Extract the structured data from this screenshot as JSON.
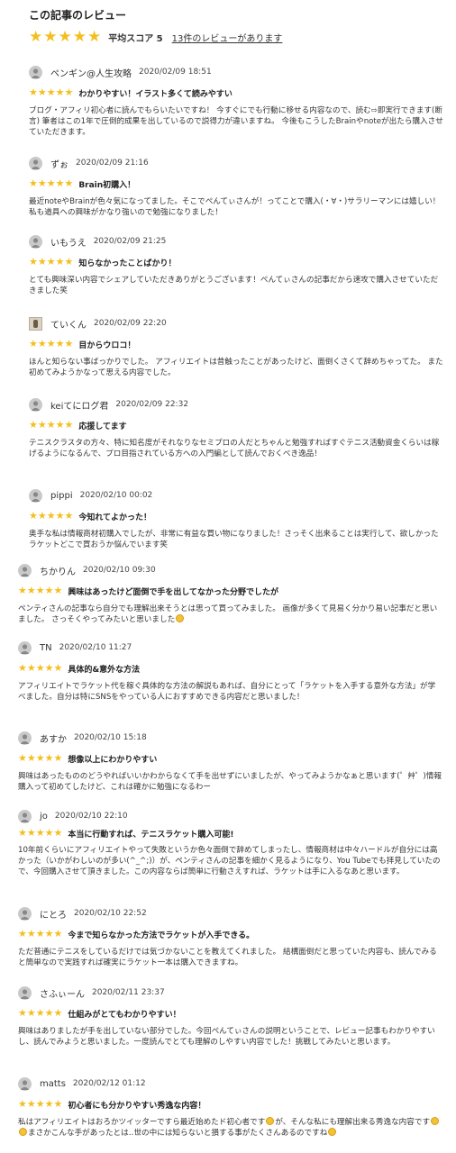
{
  "header": {
    "title": "この記事のレビュー",
    "stars": "★★★★★",
    "average_label": "平均スコア 5",
    "review_count_link": "13件のレビューがあります"
  },
  "colors": {
    "star": "#f3bf1f",
    "avatar": "#c9c9c9"
  },
  "reviews": [
    {
      "user": "ペンギン@人生攻略",
      "date": "2020/02/09 18:51",
      "stars": "★★★★★",
      "title": "わかりやすい！イラスト多くて読みやすい",
      "body_parts": [
        "ブログ・アフィリ初心者に読んでもらいたいですね！ 今すぐにでも行動に移せる内容なので、読む⇨即実行できます(断言) 筆者はこの1年で圧倒的成果を出しているので説得力が違いますね。 今後もこうしたBrainやnoteが出たら購入させていただきます。"
      ]
    },
    {
      "user": "ずぉ",
      "date": "2020/02/09 21:16",
      "stars": "★★★★★",
      "title": "Brain初購入！",
      "body_parts": [
        "最近noteやBrainが色々気になってました。そこでぺんてぃさんが！ってことで購入(・∀・)サラリーマンには嬉しい！私も道具への興味がかなり強いので勉強になりました！"
      ]
    },
    {
      "user": "いもうえ",
      "date": "2020/02/09 21:25",
      "stars": "★★★★★",
      "title": "知らなかったことばかり！",
      "body_parts": [
        "とても興味深い内容でシェアしていただきありがとうございます！ぺんてぃさんの記事だから速攻で購入させていただきました笑"
      ]
    },
    {
      "user": "ていくん",
      "date": "2020/02/09 22:20",
      "stars": "★★★★★",
      "title": "目からウロコ！",
      "body_parts": [
        "ほんと知らない事ばっかりでした。 アフィリエイトは昔触ったことがあったけど、面倒くさくて辞めちゃってた。 また初めてみようかなって思える内容でした。"
      ]
    },
    {
      "user": "keiてにログ君",
      "date": "2020/02/09 22:32",
      "stars": "★★★★★",
      "title": "応援してます",
      "body_parts": [
        "テニスクラスタの方々、特に知名度がそれなりなセミプロの人だとちゃんと勉強すればすぐテニス活動資金くらいは稼げるようになるんで、プロ目指されている方への入門編として読んでおくべき逸品！"
      ]
    },
    {
      "user": "pippi",
      "date": "2020/02/10 00:02",
      "stars": "★★★★★",
      "title": "今知れてよかった！",
      "body_parts": [
        "奥手な私は情報商材初購入でしたが、非常に有益な買い物になりました！さっそく出来ることは実行して、欲しかったラケットどこで買おうか悩んでいます笑"
      ]
    },
    {
      "user": "ちかりん",
      "date": "2020/02/10 09:30",
      "stars": "★★★★★",
      "title": "興味はあったけど面倒で手を出してなかった分野でしたが",
      "body_parts": [
        "ペンティさんの記事なら自分でも理解出来そうとは思って買ってみました。 画像が多くて見易く分かり易い記事だと思いました。 さっそくやってみたいと思いました",
        ""
      ]
    },
    {
      "user": "TN",
      "date": "2020/02/10 11:27",
      "stars": "★★★★★",
      "title": "具体的&意外な方法",
      "body_parts": [
        "アフィリエイトでラケット代を稼ぐ具体的な方法の解説もあれば、自分にとって「ラケットを入手する意外な方法」が学べました。自分は特にSNSをやっている人におすすめできる内容だと思いました！"
      ]
    },
    {
      "user": "あすか",
      "date": "2020/02/10 15:18",
      "stars": "★★★★★",
      "title": "想像以上にわかりやすい",
      "body_parts": [
        "興味はあったもののどうやればいいかわからなくて手を出せずにいましたが、やってみようかなぁと思います(゜艸゜)情報購入って初めてしたけど、これは確かに勉強になるわー"
      ]
    },
    {
      "user": "jo",
      "date": "2020/02/10 22:10",
      "stars": "★★★★★",
      "title": "本当に行動すれば、テニスラケット購入可能!",
      "body_parts": [
        "10年前くらいにアフィリエイトやって失敗というか色々面倒で辞めてしまったし、情報商材は中々ハードルが自分には高かった（いかがわしいのが多い(^_^;)）が、ペンティさんの記事を細かく見るようになり、You Tubeでも拝見していたので、今回購入させて頂きました。この内容ならば簡単に行動さえすれば、ラケットは手に入るなあと思います。"
      ]
    },
    {
      "user": "にとろ",
      "date": "2020/02/10 22:52",
      "stars": "★★★★★",
      "title": "今まで知らなかった方法でラケットが入手できる。",
      "body_parts": [
        "ただ普通にテニスをしているだけでは気づかないことを教えてくれました。 結構面倒だと思っていた内容も、読んでみると簡単なので実践すれば確実にラケット一本は購入できますね。"
      ]
    },
    {
      "user": "さふぃーん",
      "date": "2020/02/11 23:37",
      "stars": "★★★★★",
      "title": "仕組みがとてもわかりやすい！",
      "body_parts": [
        "興味はありましたが手を出していない部分でした。今回ぺんてぃさんの説明ということで、レビュー記事もわかりやすいし、読んでみようと思いました。一度読んでとても理解のしやすい内容でした！挑戦してみたいと思います。"
      ]
    },
    {
      "user": "matts",
      "date": "2020/02/12 01:12",
      "stars": "★★★★★",
      "title": "初心者にも分かりやすい秀逸な内容！",
      "body_parts": [
        "私はアフィリエイトはおろかツイッターですら最近始めたド初心者です",
        "が、そんな私にも理解出来る秀逸な内容です",
        "",
        "まさかこんな手があったとは‥世の中には知らないと損する事がたくさんあるのですね",
        ""
      ]
    }
  ]
}
